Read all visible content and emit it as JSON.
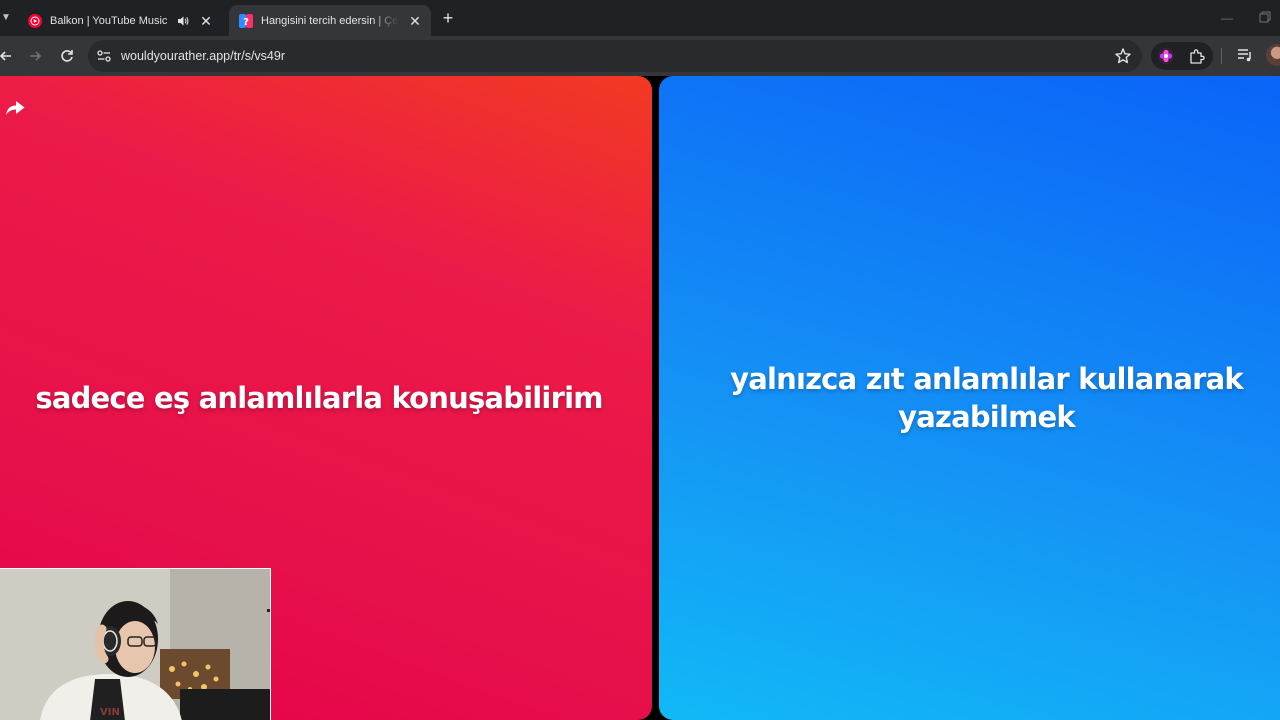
{
  "browser": {
    "tabs": [
      {
        "title": "Balkon | YouTube Music",
        "active": false,
        "favicon": "youtube-music-icon",
        "audio": true
      },
      {
        "title": "Hangisini tercih edersin | Çevrimiçi",
        "active": true,
        "favicon": "would-you-rather-icon"
      }
    ],
    "url": "wouldyourather.app/tr/s/vs49r"
  },
  "game": {
    "option_a": "sadece eş anlamlılarla konuşabilirim",
    "option_b": "yalnızca zıt anlamlılar kullanarak yazabilmek",
    "colors": {
      "option_a": "#e6104a",
      "option_b": "#0d7ff7"
    }
  }
}
